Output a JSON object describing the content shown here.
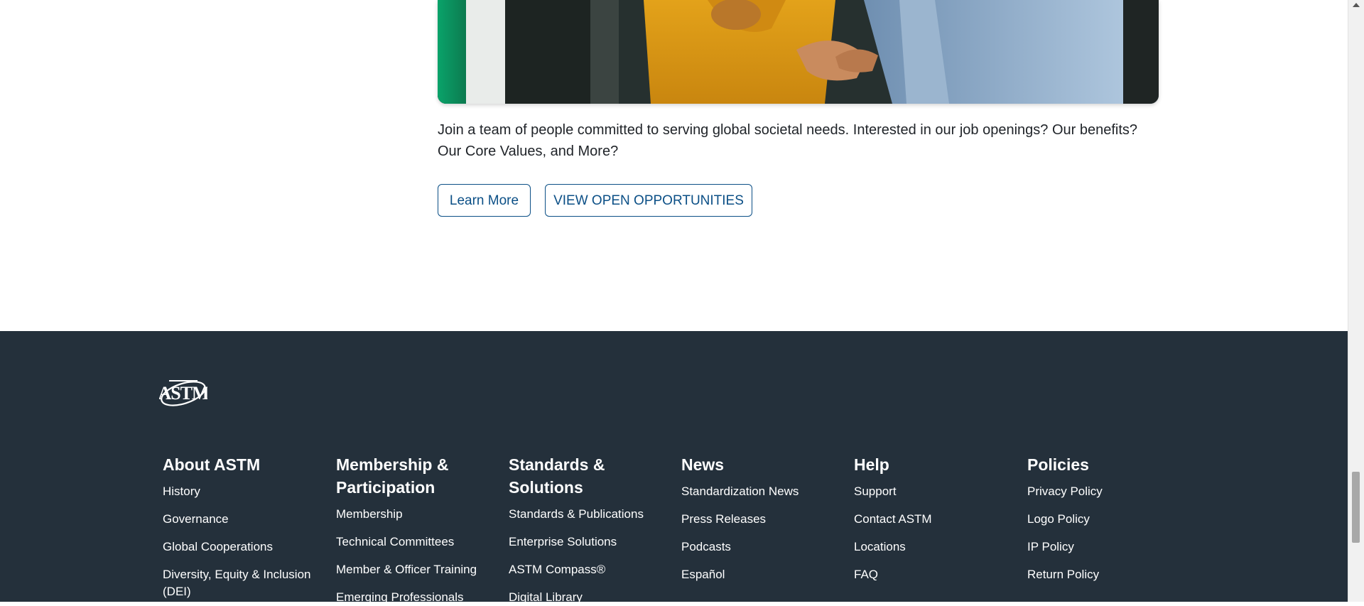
{
  "hero": {
    "image_alt": "Two people shaking hands",
    "description": "Join a team of people committed to serving global societal needs. Interested in our job openings? Our benefits? Our Core Values, and More?"
  },
  "buttons": {
    "learn_more": "Learn More",
    "view_open": "VIEW OPEN OPPORTUNITIES"
  },
  "footer": {
    "logo_icon": "astm-logo",
    "columns": [
      {
        "heading": "About ASTM",
        "links": [
          "History",
          "Governance",
          "Global Cooperations",
          "Diversity, Equity & Inclusion (DEI)"
        ]
      },
      {
        "heading": "Membership & Participation",
        "links": [
          "Membership",
          "Technical Committees",
          "Member & Officer Training",
          "Emerging Professionals"
        ]
      },
      {
        "heading": "Standards & Solutions",
        "links": [
          "Standards & Publications",
          "Enterprise Solutions",
          "ASTM Compass®",
          "Digital Library"
        ]
      },
      {
        "heading": "News",
        "links": [
          "Standardization News",
          "Press Releases",
          "Podcasts",
          "Español"
        ]
      },
      {
        "heading": "Help",
        "links": [
          "Support",
          "Contact ASTM",
          "Locations",
          "FAQ"
        ]
      },
      {
        "heading": "Policies",
        "links": [
          "Privacy Policy",
          "Logo Policy",
          "IP Policy",
          "Return Policy"
        ]
      }
    ]
  },
  "colors": {
    "footer_bg": "#24303b",
    "button_blue": "#0b4f86"
  }
}
